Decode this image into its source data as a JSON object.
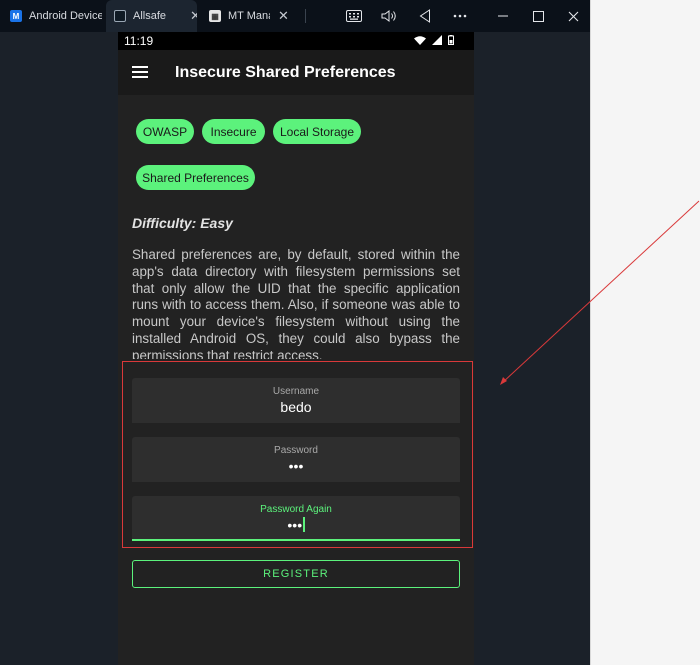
{
  "browser": {
    "tabs": [
      {
        "title": "Android Device",
        "favicon": "android-device-icon",
        "color": "#1a73e8",
        "active": false
      },
      {
        "title": "Allsafe",
        "favicon": "allsafe-icon",
        "color": "#0f1a24",
        "active": true
      },
      {
        "title": "MT Manager",
        "favicon": "mt-manager-icon",
        "color": "#e6e6e6",
        "active": false
      }
    ],
    "close_glyph": "✕",
    "controls": [
      "keyboard-icon",
      "volume-icon",
      "back-triangle-icon",
      "more-icon",
      "minimize-icon",
      "maximize-icon",
      "window-close-icon"
    ]
  },
  "phone": {
    "status": {
      "time": "11:19",
      "icons": [
        "wifi-icon",
        "signal-icon",
        "battery-icon"
      ]
    },
    "appbar": {
      "title": "Insecure Shared Preferences",
      "menu_icon": "hamburger-menu-icon"
    },
    "tags": [
      "OWASP",
      "Insecure",
      "Local Storage",
      "Shared Preferences"
    ],
    "difficulty": "Difficulty: Easy",
    "description": "Shared preferences are, by default, stored within the app's data directory with filesystem permissions set that only allow the UID that the specific application runs with to access them. Also, if someone was able to mount your device's filesystem without using the installed Android OS, they could also bypass the permissions that restrict access.",
    "form": {
      "username": {
        "label": "Username",
        "value": "bedo"
      },
      "password": {
        "label": "Password",
        "value": "•••"
      },
      "password_again": {
        "label": "Password Again",
        "value": "•••",
        "focused": true
      }
    },
    "register_label": "REGISTER"
  },
  "colors": {
    "accent": "#5cf27c",
    "annotation": "#d9393a",
    "surface": "#222222",
    "field": "#2e2e2e"
  }
}
